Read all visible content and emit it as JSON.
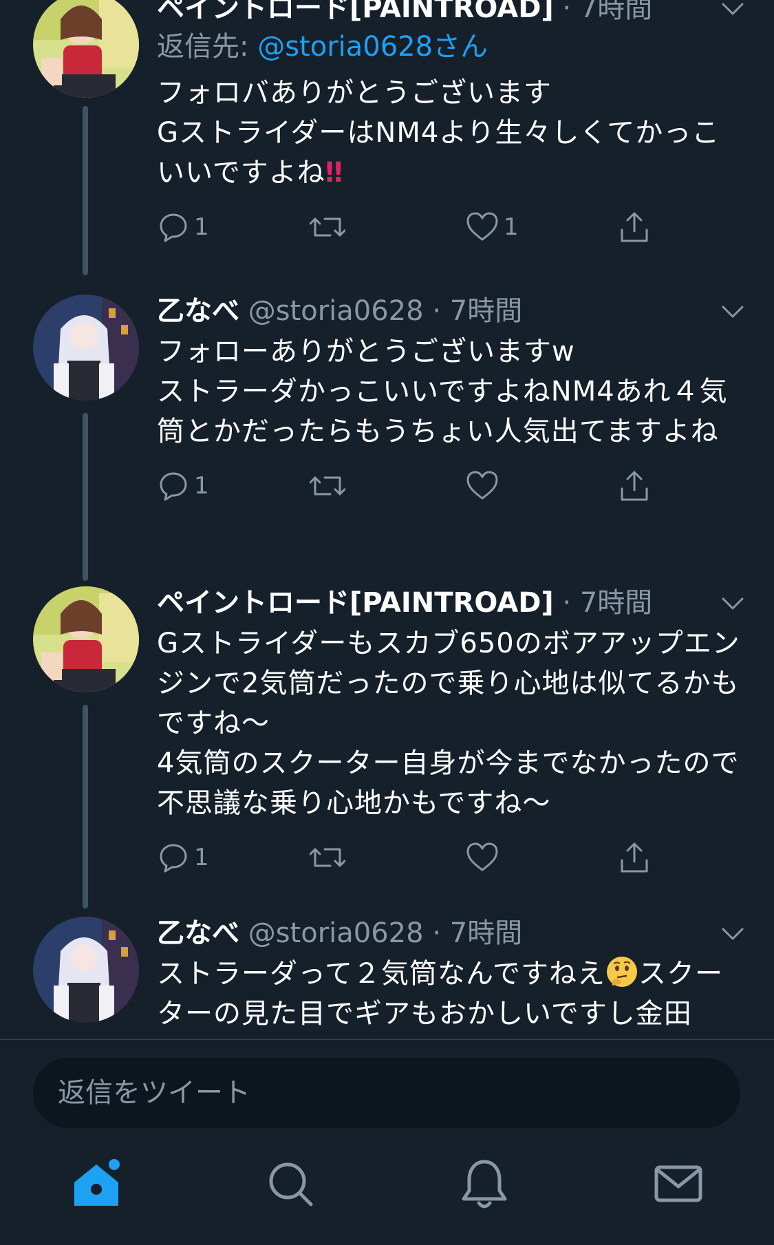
{
  "tweets": [
    {
      "name": "ペイントロード[PAINTROAD]",
      "handle": "",
      "dot": "·",
      "time": "7時間",
      "reply_prefix": "返信先: ",
      "reply_mention": "@storia0628さん",
      "body": "フォロバありがとうございます\nGストライダーはNM4より生々しくてかっこいいですよね",
      "emoji": "‼",
      "reply_count": "1",
      "like_count": "1"
    },
    {
      "name": "乙なべ",
      "handle": "@storia0628",
      "dot": "·",
      "time": "7時間",
      "body": "フォローありがとうございますw\nストラーダかっこいいですよねNM4あれ４気筒とかだったらもうちょい人気出てますよね",
      "reply_count": "1",
      "like_count": ""
    },
    {
      "name": "ペイントロード[PAINTROAD]",
      "handle": "",
      "dot": "·",
      "time": "7時間",
      "body": "Gストライダーもスカブ650のボアアップエンジンで2気筒だったので乗り心地は似てるかもですね〜\n4気筒のスクーター自身が今までなかったので不思議な乗り心地かもですね〜",
      "reply_count": "1",
      "like_count": ""
    },
    {
      "name": "乙なべ",
      "handle": "@storia0628",
      "dot": "·",
      "time": "7時間",
      "body_before_emoji": "ストラーダって２気筒なんですねえ",
      "emoji_name": "thinking-face",
      "body_after_emoji": "スクーターの見た目でギアもおかしいですし金田"
    }
  ],
  "reply_bar": {
    "placeholder": "返信をツイート"
  },
  "nav": {
    "items": [
      "home-icon",
      "search-icon",
      "notifications-icon",
      "messages-icon"
    ],
    "active": "home-icon"
  },
  "colors": {
    "background": "#15202b",
    "accent": "#1da1f2",
    "secondary_text": "#8899a6",
    "thread_line": "#3d5466"
  }
}
